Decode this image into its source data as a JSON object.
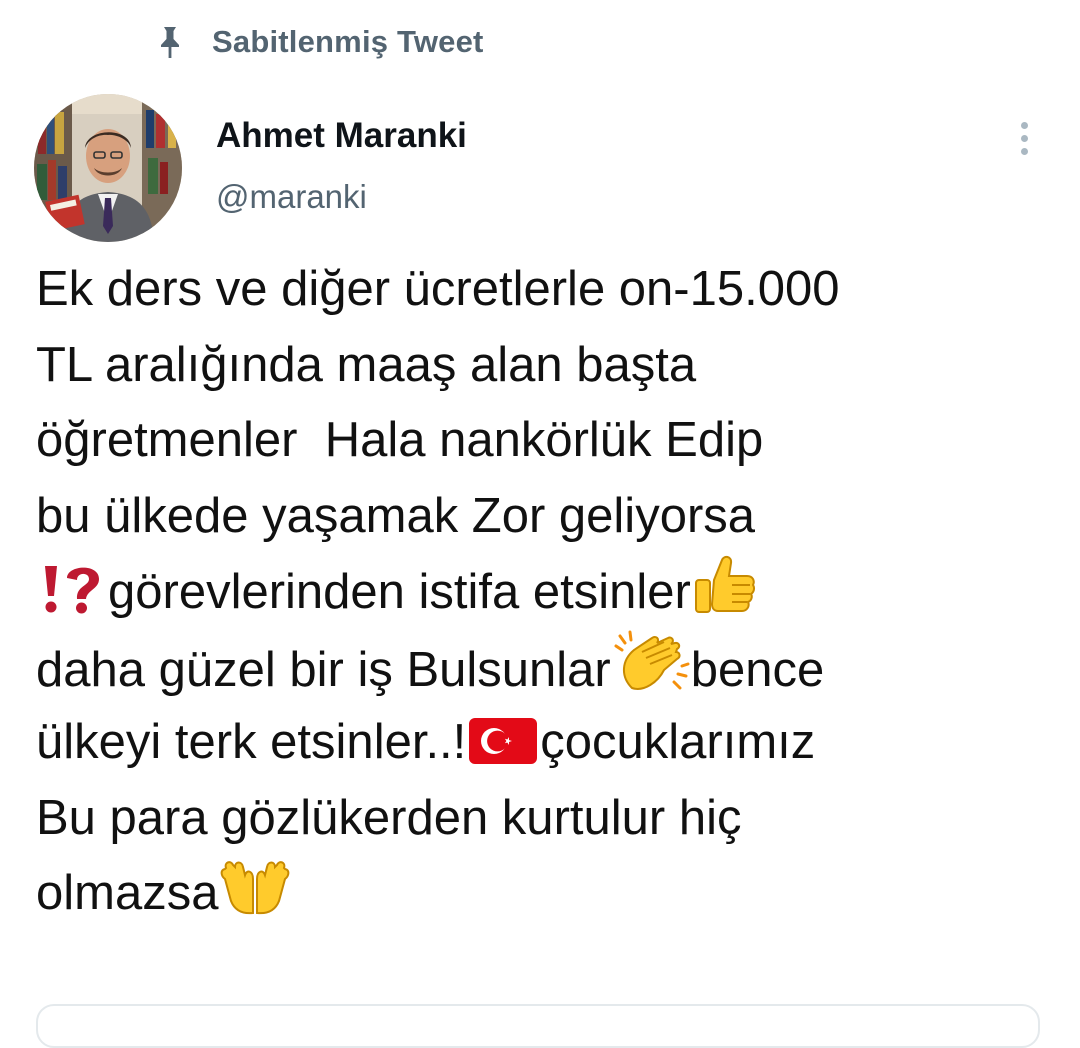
{
  "pinned": {
    "icon": "pin-icon",
    "label": "Sabitlenmiş Tweet"
  },
  "author": {
    "name": "Ahmet Maranki",
    "handle": "@maranki"
  },
  "menu": {
    "icon": "more-options-icon"
  },
  "tweet": {
    "line1": "Ek ders ve diğer ücretlerle on-15.000",
    "line2": "TL aralığında maaş alan başta",
    "line3": "öğretmenler  Hala nankörlük Edip",
    "line4": "bu ülkede yaşamak Zor geliyorsa",
    "line5": "görevlerinden istifa etsinler",
    "line6a": "daha güzel bir iş Bulsunlar",
    "line6b": "bence",
    "line7a": "ülkeyi terk etsinler..!",
    "line7b": "çocuklarımız",
    "line8": "Bu para gözlükerden kurtulur hiç",
    "line9": "olmazsa",
    "emojis": {
      "interrobang": "exclamation-question-mark-emoji",
      "thumbs_up": "thumbs-up-emoji",
      "clapping": "clapping-hands-emoji",
      "flag": "turkey-flag-emoji",
      "palms_up": "palms-up-together-emoji"
    }
  },
  "colors": {
    "secondary_text": "#536471",
    "primary_text": "#0f1419",
    "interrobang_red": "#be1931",
    "emoji_yellow": "#ffcb2c",
    "flag_red": "#e30a17"
  }
}
